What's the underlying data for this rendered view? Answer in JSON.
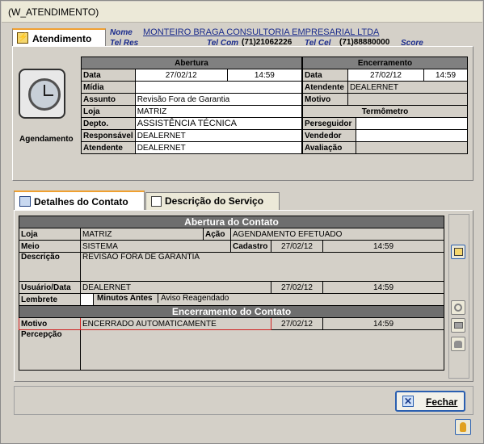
{
  "window": {
    "title": "(W_ATENDIMENTO)"
  },
  "header": {
    "tab_label": "Atendimento",
    "nome_label": "Nome",
    "nome_value": "MONTEIRO BRAGA CONSULTORIA EMPRESARIAL LTDA",
    "telres_label": "Tel Res",
    "telcom_label": "Tel Com",
    "telcom_value": "(71)21062226",
    "telcel_label": "Tel Cel",
    "telcel_value": "(71)88880000",
    "score_label": "Score"
  },
  "agendamento": {
    "icon_label": "Agendamento",
    "abertura_header": "Abertura",
    "encerramento_header": "Encerramento",
    "termometro_header": "Termômetro",
    "data_label": "Data",
    "abertura_date": "27/02/12",
    "abertura_time": "14:59",
    "enc_data_label": "Data",
    "enc_date": "27/02/12",
    "enc_time": "14:59",
    "midia_label": "Mídia",
    "midia_value": "",
    "atendente_enc_label": "Atendente",
    "atendente_enc_value": "DEALERNET",
    "assunto_label": "Assunto",
    "assunto_value": "Revisão Fora de Garantia",
    "motivo_label": "Motivo",
    "loja_label": "Loja",
    "loja_value": "MATRIZ",
    "depto_label": "Depto.",
    "depto_value": "ASSISTÊNCIA TÉCNICA",
    "perseguidor_label": "Perseguidor",
    "responsavel_label": "Responsável",
    "responsavel_value": "DEALERNET",
    "vendedor_label": "Vendedor",
    "atendente_label": "Atendente",
    "atendente_value": "DEALERNET",
    "avaliacao_label": "Avaliação"
  },
  "tabs": {
    "detalhes_label": "Detalhes do Contato",
    "descricao_label": "Descrição do Serviço"
  },
  "contato": {
    "abertura_header": "Abertura do Contato",
    "loja_label": "Loja",
    "loja_value": "MATRIZ",
    "acao_label": "Ação",
    "acao_value": "AGENDAMENTO EFETUADO",
    "meio_label": "Meio",
    "meio_value": "SISTEMA",
    "cadastro_label": "Cadastro",
    "cadastro_date": "27/02/12",
    "cadastro_time": "14:59",
    "descricao_label": "Descrição",
    "descricao_value": "REVISÃO FORA DE GARANTIA",
    "usuario_label": "Usuário/Data",
    "usuario_value": "DEALERNET",
    "usuario_date": "27/02/12",
    "usuario_time": "14:59",
    "lembrete_label": "Lembrete",
    "minutos_label": "Minutos Antes",
    "minutos_value": "Aviso Reagendado",
    "encerramento_header": "Encerramento do Contato",
    "motivo_label": "Motivo",
    "motivo_value": "ENCERRADO AUTOMATICAMENTE",
    "motivo_date": "27/02/12",
    "motivo_time": "14:59",
    "percepcao_label": "Percepção",
    "percepcao_value": ""
  },
  "footer": {
    "fechar_label": "Fechar"
  }
}
